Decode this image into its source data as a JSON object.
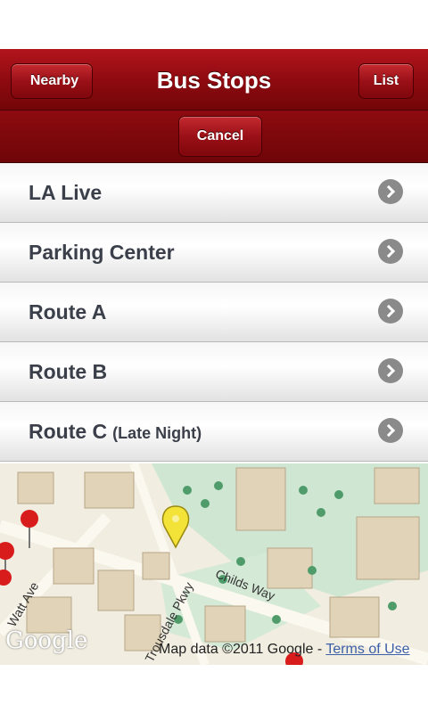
{
  "navbar": {
    "title": "Bus Stops",
    "back_label": "Nearby",
    "list_label": "List"
  },
  "subbar": {
    "cancel_label": "Cancel"
  },
  "stops": [
    {
      "label": "LA Live",
      "sub": ""
    },
    {
      "label": "Parking Center",
      "sub": ""
    },
    {
      "label": "Route A",
      "sub": ""
    },
    {
      "label": "Route B",
      "sub": ""
    },
    {
      "label": "Route C",
      "sub": "(Late Night)"
    }
  ],
  "map": {
    "logo": "Google",
    "credit": "Map data ©2011 Google - ",
    "terms": "Terms of Use",
    "streets": [
      "Childs Way",
      "Trousdale Pkwy",
      "Watt Ave"
    ]
  },
  "colors": {
    "navbar": "#8c0a10",
    "row_text": "#3a3f4a"
  }
}
